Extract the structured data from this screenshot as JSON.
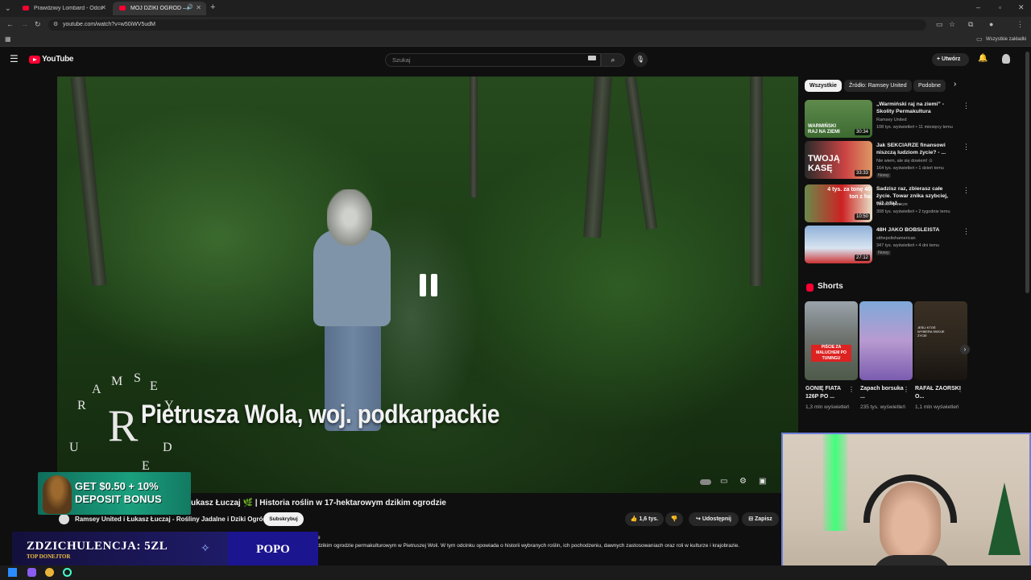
{
  "browser": {
    "tabs": [
      {
        "label": "Prawdziwy Lombard - Odcinek"
      },
      {
        "label": "MÓJ DZIKI OGRÓD – dzie"
      }
    ],
    "url": "youtube.com/watch?v=w50iWV5udM",
    "bookmarks_all": "Wszystkie zakładki"
  },
  "youtube": {
    "logo": "YouTube",
    "search_placeholder": "Szukaj",
    "create_label": "Utwórz"
  },
  "video": {
    "caption": "Pietrusza Wola, woj. podkarpackie",
    "watermark_letters": [
      "R",
      "A",
      "M",
      "S",
      "E",
      "Y",
      "U",
      "N",
      "I",
      "T",
      "E",
      "D"
    ],
    "title": "ukasz Łuczaj 🌿 | Historia roślin w 17-hektarowym dzikim ogrodzie",
    "channel": "Ramsey United i Łukasz Łuczaj - Rośliny Jadalne i Dziki Ogród",
    "subscribe_label": "Subskrybuj",
    "likes": "1,6 tys.",
    "share_label": "Udostępnij",
    "save_label": "Zapisz",
    "description_prefix": "e",
    "description": "dzikim ogrodzie permakulturowym w Pietruszej Woli. W tym odcinku opowiada o historii wybranych roślin, ich pochodzeniu, dawnych zastosowaniach oraz roli w kulturze i krajobrazie."
  },
  "filters": {
    "chips": [
      "Wszystkie",
      "Źródło: Ramsey United",
      "Podobne"
    ]
  },
  "recommendations": [
    {
      "title": "„Warmiński raj na ziemi” - Skolity Permakultura",
      "channel": "Ramsey United",
      "meta": "108 tys. wyświetleń • 11 miesięcy temu",
      "duration": "30:34",
      "thumb_text": "WARMIŃSKI RAJ NA ZIEMI",
      "badge": ""
    },
    {
      "title": "Jak SEKCIARZE finansowi niszczą ludziom życie? - ...",
      "channel": "Nie wiem, ale się dowiem! ⊙",
      "meta": "164 tys. wyświetleń • 1 dzień temu",
      "duration": "33:33",
      "thumb_text": "TWOJĄ KASĘ",
      "badge": "Nowy"
    },
    {
      "title": "Sadzisz raz, zbierasz całe życie. Towar znika szybciej, niż zdąż...",
      "channel": "Wieści Rolnicze",
      "meta": "308 tys. wyświetleń • 2 tygodnie temu",
      "duration": "10:50",
      "thumb_text": "4 tys. za tonę 40 ton z ha",
      "badge": ""
    },
    {
      "title": "48H JAKO BOBSLEISTA",
      "channel": "sithepolishamerican",
      "meta": "347 tys. wyświetleń • 4 dni temu",
      "duration": "27:12",
      "thumb_text": "",
      "badge": "Nowy"
    }
  ],
  "shorts": {
    "heading": "Shorts",
    "items": [
      {
        "title": "GONIĘ FIATA 126P PO ...",
        "views": "1,3 mln wyświetleń",
        "thumb_text": "PIŚCIE ZA MALUCHEM PO TUNINGU"
      },
      {
        "title": "Zapach borsuka ...",
        "views": "235 tys. wyświetleń",
        "thumb_text": ""
      },
      {
        "title": "RAFAŁ ZAORSKI O...",
        "views": "1,1 mln wyświetleń",
        "thumb_text": "JEŚLI KTOŚ WYBIERA SWOJE ŻYCIE"
      }
    ]
  },
  "overlays": {
    "ad_line1": "GET $0.50 + 10%",
    "ad_line2": "DEPOSIT BONUS",
    "donation_text": "ZDZICHULENCJA: 5ZL",
    "donation_sub": "TOP DONEJTOR",
    "donation_name": "POPO"
  },
  "colors": {
    "yt_red": "#ff0033",
    "background": "#0f0f0f",
    "webcam_border": "#6f7fd8"
  }
}
